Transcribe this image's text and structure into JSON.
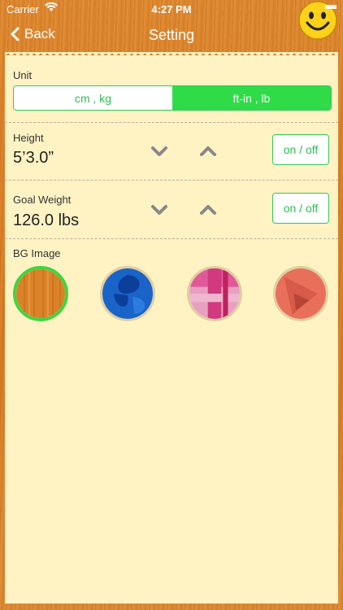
{
  "status": {
    "carrier": "Carrier",
    "time": "4:27 PM"
  },
  "nav": {
    "back_label": "Back",
    "title": "Setting"
  },
  "unit": {
    "label": "Unit",
    "options": [
      "cm , kg",
      "ft-in , lb"
    ],
    "selected": "ft-in , lb"
  },
  "height": {
    "label": "Height",
    "value": "5’3.0”",
    "toggle_label": "on / off"
  },
  "goal_weight": {
    "label": "Goal Weight",
    "value": "126.0 lbs",
    "toggle_label": "on / off"
  },
  "bg_image": {
    "label": "BG Image",
    "options": [
      "wood-orange",
      "blue-petals",
      "pink-plaid",
      "coral-abstract"
    ],
    "selected": "wood-orange"
  },
  "colors": {
    "accent_green": "#2fdc48",
    "panel": "#fff3c4",
    "wood": "#d97b22"
  }
}
